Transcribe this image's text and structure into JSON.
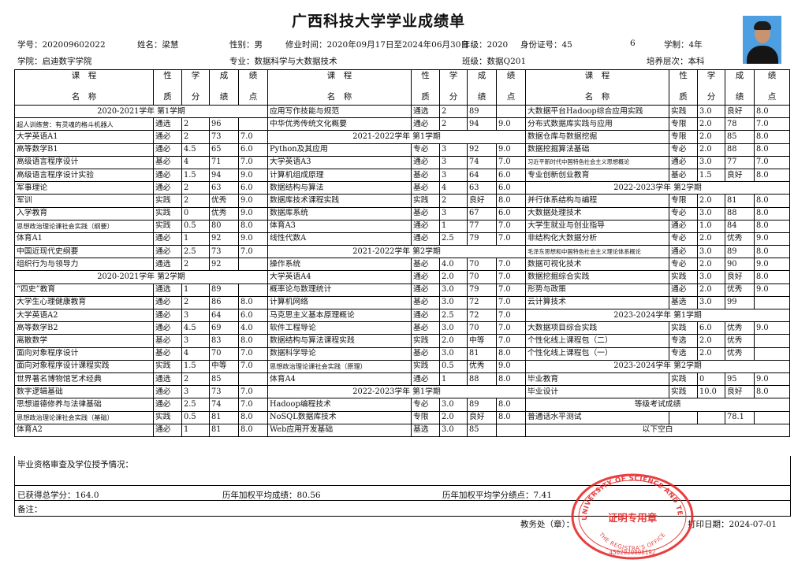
{
  "title": "广西科技大学学业成绩单",
  "info": {
    "student_id": "学号：202009602022",
    "name": "姓名：梁慧",
    "gender": "性别：男",
    "study_period": "修业时间：2020年09月17日至2024年06月30日",
    "grade": "年级：2020",
    "id_number": "身份证号：45",
    "id_suffix": "6",
    "duration": "学制：4年",
    "college": "学院：启迪数字学院",
    "major": "专业：数据科学与大数据技术",
    "class": "班级：数据Q201",
    "level": "培养层次：本科"
  },
  "header": {
    "course_top": "课　程",
    "course_bottom": "名　称",
    "nature_top": "性",
    "nature_bottom": "质",
    "credit_top": "学",
    "credit_bottom": "分",
    "score_top": "成",
    "score_bottom": "绩",
    "gpa_top": "绩",
    "gpa_bottom": "点"
  },
  "columns": [
    [
      {
        "section": "2020-2021学年 第1学期"
      },
      {
        "name": "超人训练营：有灵魂的格斗机器人",
        "type": "通选",
        "credit": "2",
        "score": "96",
        "gpa": "",
        "size": "sm"
      },
      {
        "name": "大学英语A1",
        "type": "通必",
        "credit": "2",
        "score": "73",
        "gpa": "7.0"
      },
      {
        "name": "高等数学B1",
        "type": "通必",
        "credit": "4.5",
        "score": "65",
        "gpa": "6.0"
      },
      {
        "name": "高级语言程序设计",
        "type": "基必",
        "credit": "4",
        "score": "71",
        "gpa": "7.0"
      },
      {
        "name": "高级语言程序设计实验",
        "type": "通必",
        "credit": "1.5",
        "score": "94",
        "gpa": "9.0"
      },
      {
        "name": "军事理论",
        "type": "通必",
        "credit": "2",
        "score": "63",
        "gpa": "6.0"
      },
      {
        "name": "军训",
        "type": "实践",
        "credit": "2",
        "score": "优秀",
        "gpa": "9.0"
      },
      {
        "name": "入学教育",
        "type": "实践",
        "credit": "0",
        "score": "优秀",
        "gpa": "9.0"
      },
      {
        "name": "思想政治理论课社会实践（纲要）",
        "type": "实践",
        "credit": "0.5",
        "score": "80",
        "gpa": "8.0",
        "size": "sm"
      },
      {
        "name": "体育A1",
        "type": "通必",
        "credit": "1",
        "score": "92",
        "gpa": "9.0"
      },
      {
        "name": "中国近现代史纲要",
        "type": "通必",
        "credit": "2.5",
        "score": "73",
        "gpa": "7.0"
      },
      {
        "name": "组织行为与领导力",
        "type": "通选",
        "credit": "2",
        "score": "92",
        "gpa": ""
      },
      {
        "section": "2020-2021学年 第2学期"
      },
      {
        "name": "“四史”教育",
        "type": "通选",
        "credit": "1",
        "score": "89",
        "gpa": ""
      },
      {
        "name": "大学生心理健康教育",
        "type": "通必",
        "credit": "2",
        "score": "86",
        "gpa": "8.0"
      },
      {
        "name": "大学英语A2",
        "type": "通必",
        "credit": "3",
        "score": "64",
        "gpa": "6.0"
      },
      {
        "name": "高等数学B2",
        "type": "通必",
        "credit": "4.5",
        "score": "69",
        "gpa": "4.0"
      },
      {
        "name": "离散数学",
        "type": "基必",
        "credit": "3",
        "score": "83",
        "gpa": "8.0"
      },
      {
        "name": "面向对象程序设计",
        "type": "基必",
        "credit": "4",
        "score": "70",
        "gpa": "7.0"
      },
      {
        "name": "面向对象程序设计课程实践",
        "type": "实践",
        "credit": "1.5",
        "score": "中等",
        "gpa": "7.0"
      },
      {
        "name": "世界著名博物馆艺术经典",
        "type": "通选",
        "credit": "2",
        "score": "85",
        "gpa": ""
      },
      {
        "name": "数字逻辑基础",
        "type": "通必",
        "credit": "3",
        "score": "73",
        "gpa": "7.0"
      },
      {
        "name": "思想道德修养与法律基础",
        "type": "通必",
        "credit": "2.5",
        "score": "74",
        "gpa": "7.0"
      },
      {
        "name": "思想政治理论课社会实践（基础）",
        "type": "实践",
        "credit": "0.5",
        "score": "81",
        "gpa": "8.0",
        "size": "sm"
      },
      {
        "name": "体育A2",
        "type": "通必",
        "credit": "1",
        "score": "81",
        "gpa": "8.0"
      }
    ],
    [
      {
        "name": "应用写作技能与规范",
        "type": "通选",
        "credit": "2",
        "score": "89",
        "gpa": ""
      },
      {
        "name": "中华优秀传统文化概要",
        "type": "通必",
        "credit": "2",
        "score": "94",
        "gpa": "9.0"
      },
      {
        "section": "2021-2022学年 第1学期"
      },
      {
        "name": "Python及其应用",
        "type": "专必",
        "credit": "3",
        "score": "92",
        "gpa": "9.0"
      },
      {
        "name": "大学英语A3",
        "type": "通必",
        "credit": "3",
        "score": "74",
        "gpa": "7.0"
      },
      {
        "name": "计算机组成原理",
        "type": "基必",
        "credit": "3",
        "score": "64",
        "gpa": "6.0"
      },
      {
        "name": "数据结构与算法",
        "type": "基必",
        "credit": "4",
        "score": "63",
        "gpa": "6.0"
      },
      {
        "name": "数据库技术课程实践",
        "type": "实践",
        "credit": "2",
        "score": "良好",
        "gpa": "8.0"
      },
      {
        "name": "数据库系统",
        "type": "基必",
        "credit": "3",
        "score": "67",
        "gpa": "6.0"
      },
      {
        "name": "体育A3",
        "type": "通必",
        "credit": "1",
        "score": "77",
        "gpa": "7.0"
      },
      {
        "name": "线性代数A",
        "type": "通必",
        "credit": "2.5",
        "score": "79",
        "gpa": "7.0"
      },
      {
        "section": "2021-2022学年 第2学期"
      },
      {
        "name": "操作系统",
        "type": "基必",
        "credit": "4.0",
        "score": "70",
        "gpa": "7.0"
      },
      {
        "name": "大学英语A4",
        "type": "通必",
        "credit": "2.0",
        "score": "70",
        "gpa": "7.0"
      },
      {
        "name": "概率论与数理统计",
        "type": "通必",
        "credit": "3.0",
        "score": "79",
        "gpa": "7.0"
      },
      {
        "name": "计算机网络",
        "type": "基必",
        "credit": "3.0",
        "score": "72",
        "gpa": "7.0"
      },
      {
        "name": "马克思主义基本原理概论",
        "type": "通必",
        "credit": "2.5",
        "score": "72",
        "gpa": "7.0"
      },
      {
        "name": "软件工程导论",
        "type": "基必",
        "credit": "3.0",
        "score": "70",
        "gpa": "7.0"
      },
      {
        "name": "数据结构与算法课程实践",
        "type": "实践",
        "credit": "2.0",
        "score": "中等",
        "gpa": "7.0"
      },
      {
        "name": "数据科学导论",
        "type": "基必",
        "credit": "3.0",
        "score": "81",
        "gpa": "8.0"
      },
      {
        "name": "思想政治理论课社会实践（原理）",
        "type": "实践",
        "credit": "0.5",
        "score": "优秀",
        "gpa": "9.0",
        "size": "sm"
      },
      {
        "name": "体育A4",
        "type": "通必",
        "credit": "1",
        "score": "88",
        "gpa": "8.0"
      },
      {
        "section": "2022-2023学年 第1学期"
      },
      {
        "name": "Hadoop编程技术",
        "type": "专必",
        "credit": "3.0",
        "score": "89",
        "gpa": "8.0"
      },
      {
        "name": "NoSQL数据库技术",
        "type": "专限",
        "credit": "2.0",
        "score": "良好",
        "gpa": "8.0"
      },
      {
        "name": "Web应用开发基础",
        "type": "基选",
        "credit": "3.0",
        "score": "85",
        "gpa": ""
      }
    ],
    [
      {
        "name": "大数据平台Hadoop综合应用实践",
        "type": "实践",
        "credit": "3.0",
        "score": "良好",
        "gpa": "8.0"
      },
      {
        "name": "分布式数据库实践与应用",
        "type": "专限",
        "credit": "2.0",
        "score": "78",
        "gpa": "7.0"
      },
      {
        "name": "数据仓库与数据挖掘",
        "type": "专限",
        "credit": "2.0",
        "score": "85",
        "gpa": "8.0"
      },
      {
        "name": "数据挖掘算法基础",
        "type": "专必",
        "credit": "2.0",
        "score": "88",
        "gpa": "8.0"
      },
      {
        "name": "习近平新时代中国特色社会主义思想概论",
        "type": "通必",
        "credit": "3.0",
        "score": "77",
        "gpa": "7.0",
        "size": "xs"
      },
      {
        "name": "专业创新创业教育",
        "type": "基必",
        "credit": "1.5",
        "score": "良好",
        "gpa": "8.0"
      },
      {
        "section": "2022-2023学年 第2学期"
      },
      {
        "name": "并行体系结构与编程",
        "type": "专限",
        "credit": "2.0",
        "score": "81",
        "gpa": "8.0"
      },
      {
        "name": "大数据处理技术",
        "type": "专必",
        "credit": "3.0",
        "score": "88",
        "gpa": "8.0"
      },
      {
        "name": "大学生就业与创业指导",
        "type": "通必",
        "credit": "1.0",
        "score": "84",
        "gpa": "8.0"
      },
      {
        "name": "非结构化大数据分析",
        "type": "专必",
        "credit": "2.0",
        "score": "优秀",
        "gpa": "9.0"
      },
      {
        "name": "毛泽东思想和中国特色社会主义理论体系概论",
        "type": "通必",
        "credit": "3.0",
        "score": "89",
        "gpa": "8.0",
        "size": "xs"
      },
      {
        "name": "数据可视化技术",
        "type": "专必",
        "credit": "2.0",
        "score": "90",
        "gpa": "9.0"
      },
      {
        "name": "数据挖掘综合实践",
        "type": "实践",
        "credit": "3.0",
        "score": "良好",
        "gpa": "8.0"
      },
      {
        "name": "形势与政策",
        "type": "通必",
        "credit": "2.0",
        "score": "优秀",
        "gpa": "9.0"
      },
      {
        "name": "云计算技术",
        "type": "基选",
        "credit": "3.0",
        "score": "99",
        "gpa": ""
      },
      {
        "section": "2023-2024学年 第1学期"
      },
      {
        "name": "大数据项目综合实践",
        "type": "实践",
        "credit": "6.0",
        "score": "优秀",
        "gpa": "9.0"
      },
      {
        "name": "个性化线上课程包（二）",
        "type": "专选",
        "credit": "2.0",
        "score": "优秀",
        "gpa": ""
      },
      {
        "name": "个性化线上课程包（一）",
        "type": "专选",
        "credit": "2.0",
        "score": "优秀",
        "gpa": ""
      },
      {
        "section": "2023-2024学年 第2学期"
      },
      {
        "name": "毕业教育",
        "type": "实践",
        "credit": "0",
        "score": "95",
        "gpa": "9.0"
      },
      {
        "name": "毕业设计",
        "type": "实践",
        "credit": "10.0",
        "score": "良好",
        "gpa": "8.0"
      },
      {
        "section": "等级考试成绩"
      },
      {
        "name": "普通话水平测试",
        "type": "",
        "credit": "",
        "score": "78.1",
        "gpa": ""
      },
      {
        "section": "以下空白"
      }
    ]
  ],
  "bottom": {
    "review": "毕业资格审查及学位授予情况：",
    "total_credits": "已获得总学分：164.0",
    "weighted_avg": "历年加权平均成绩：80.56",
    "weighted_gpa": "历年加权平均学分绩点：7.41",
    "remarks": "备注："
  },
  "footer": {
    "office": "教务处（章）：",
    "print_label": "打印日期：2024-07-01"
  },
  "seal": {
    "text_outer": "GUANGXI UNIVERSITY OF SCIENCE AND TECHNOLOGY",
    "text_center": "证明专用章",
    "text_bottom": "THE REGISTRA'S OFFICE",
    "number": "4502020008192",
    "color": "#e52424"
  }
}
